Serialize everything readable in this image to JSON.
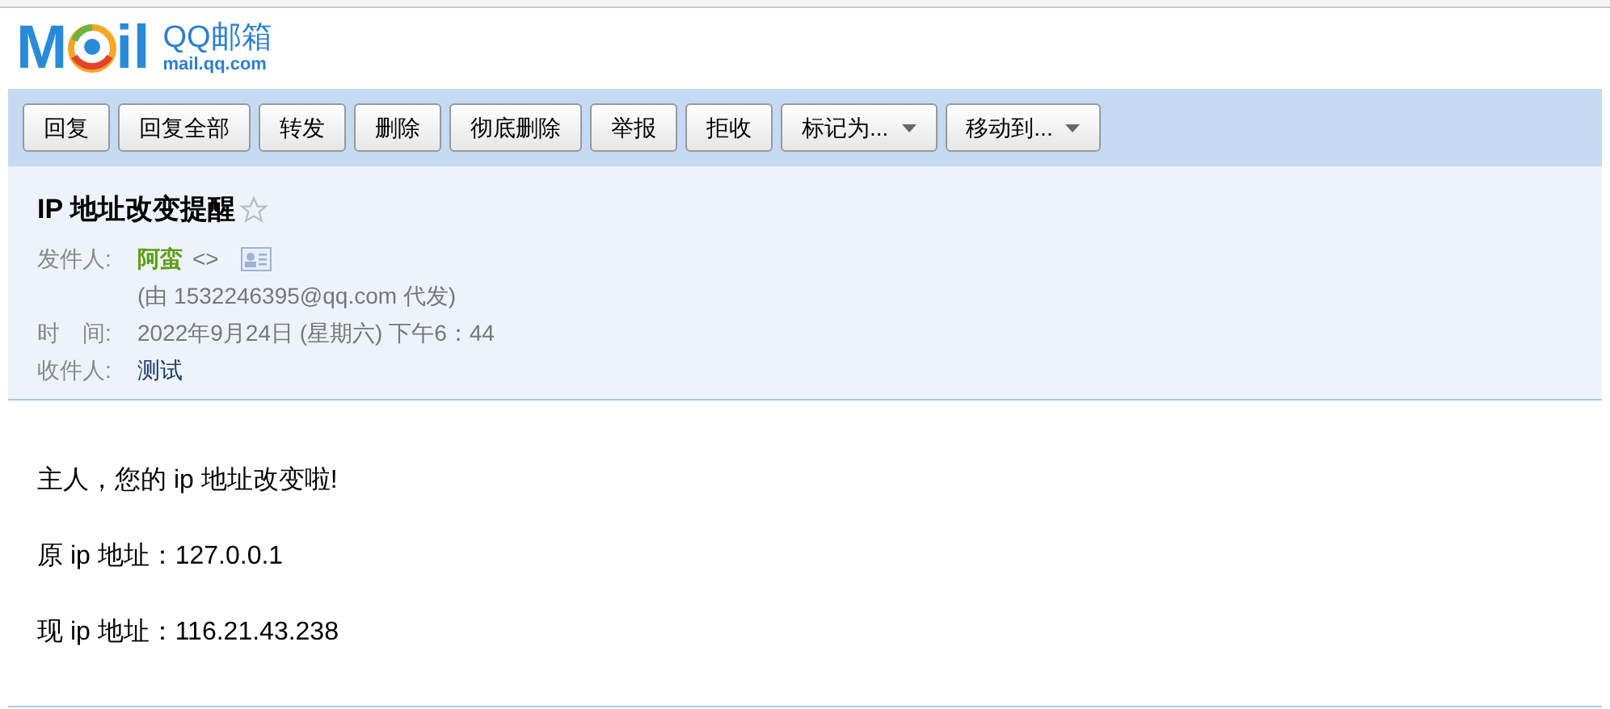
{
  "logo": {
    "left": "M",
    "right": "il",
    "name": "QQ邮箱",
    "domain": "mail.qq.com"
  },
  "toolbar": [
    {
      "label": "回复",
      "kind": "button"
    },
    {
      "label": "回复全部",
      "kind": "button"
    },
    {
      "label": "转发",
      "kind": "button"
    },
    {
      "label": "删除",
      "kind": "button"
    },
    {
      "label": "彻底删除",
      "kind": "button"
    },
    {
      "label": "举报",
      "kind": "button"
    },
    {
      "label": "拒收",
      "kind": "button"
    },
    {
      "label": "标记为...",
      "kind": "menu"
    },
    {
      "label": "移动到...",
      "kind": "menu"
    }
  ],
  "mail": {
    "subject": "IP 地址改变提醒",
    "starred": false,
    "sender_label": "发件人:",
    "sender_name": "阿蛮",
    "sender_address": "<>",
    "sender_via": "(由 1532246395@qq.com 代发)",
    "time_label": "时　间:",
    "time": "2022年9月24日 (星期六) 下午6：44",
    "recipient_label": "收件人:",
    "recipient": "测试"
  },
  "body": [
    "主人，您的 ip 地址改变啦!",
    "原 ip 地址：127.0.0.1",
    "现 ip 地址：116.21.43.238"
  ]
}
